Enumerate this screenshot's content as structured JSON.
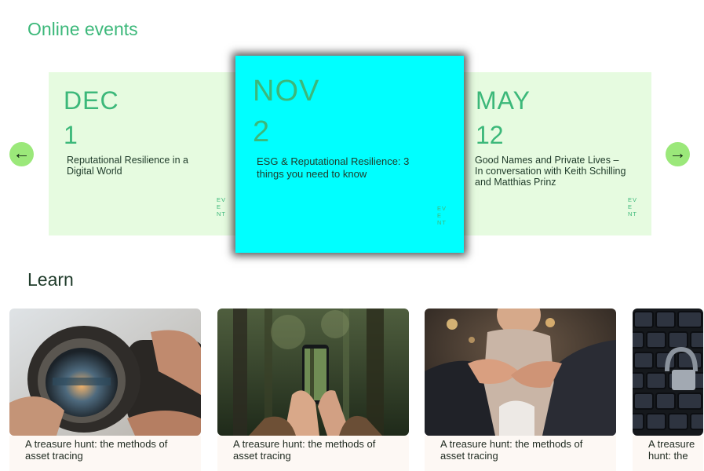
{
  "online_events": {
    "title": "Online events",
    "prev_symbol": "←",
    "next_symbol": "→",
    "cards": [
      {
        "month": "DEC",
        "day": "1",
        "title": "Reputational Resilience in a Digital World",
        "tag": "EVENT"
      },
      {
        "month": "NOV",
        "day": "2",
        "title": "ESG & Reputational Resilience: 3 things you need to know",
        "tag": "EVENT"
      },
      {
        "month": "MAY",
        "day": "12",
        "title": "Good Names and Private Lives – In conversation with Keith Schilling and Matthias Prinz",
        "tag": "EVENT"
      }
    ]
  },
  "learn": {
    "title": "Learn",
    "cards": [
      {
        "caption": "A treasure hunt: the methods of asset tracing",
        "image": "binoculars-photo"
      },
      {
        "caption": "A treasure hunt: the methods of asset tracing",
        "image": "phone-forest-photo"
      },
      {
        "caption": "A treasure hunt: the methods of asset tracing",
        "image": "handshake-photo"
      },
      {
        "caption": "A treasure hunt: the",
        "image": "keyboard-lock-photo"
      }
    ]
  },
  "colors": {
    "accent_green": "#3cb87a",
    "card_bg": "#e6fbe0",
    "active_card_bg": "#00ffff",
    "arrow_bg": "#9be87a"
  }
}
